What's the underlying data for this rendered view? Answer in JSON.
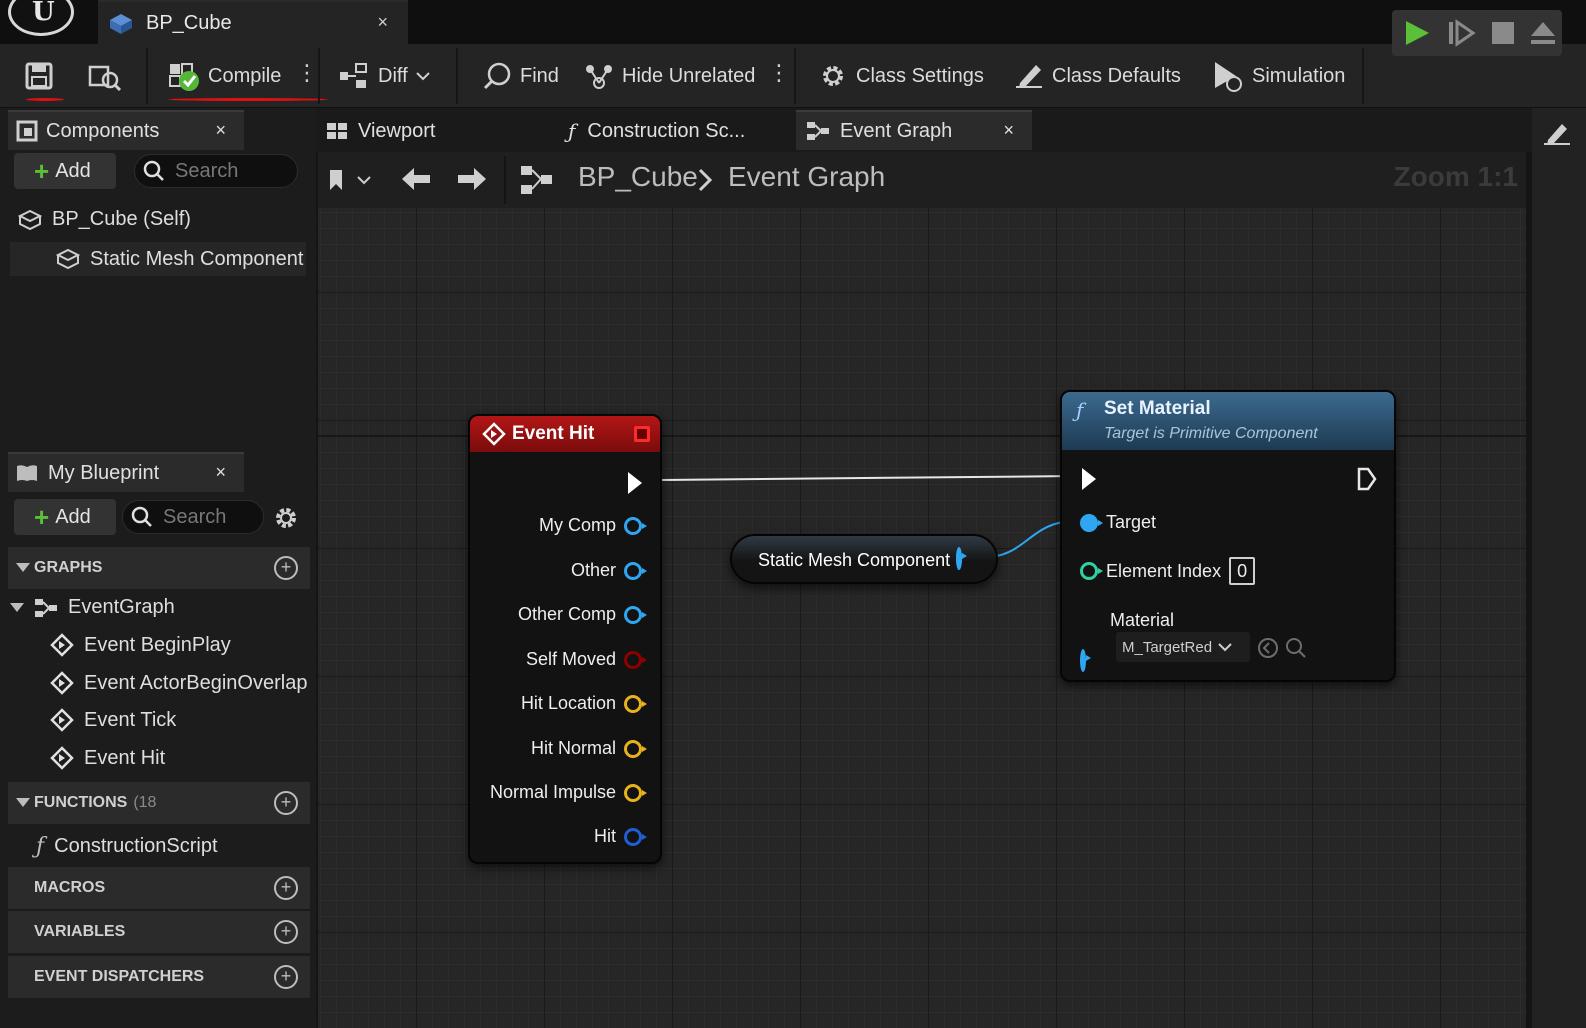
{
  "window": {
    "tab_title": "BP_Cube",
    "tab_close": "×"
  },
  "toolbar": {
    "compile": "Compile",
    "diff": "Diff",
    "find": "Find",
    "hide_unrelated": "Hide Unrelated",
    "class_settings": "Class Settings",
    "class_defaults": "Class Defaults",
    "simulation": "Simulation",
    "more": "⋮"
  },
  "components": {
    "tab": "Components",
    "close": "×",
    "add": "Add",
    "search_placeholder": "Search",
    "items": [
      "BP_Cube (Self)",
      "Static Mesh Component"
    ]
  },
  "my_blueprint": {
    "tab": "My Blueprint",
    "close": "×",
    "add": "Add",
    "search_placeholder": "Search",
    "graphs_header": "GRAPHS",
    "event_graph": "EventGraph",
    "events": [
      "Event BeginPlay",
      "Event ActorBeginOverlap",
      "Event Tick",
      "Event Hit"
    ],
    "functions_header": "FUNCTIONS",
    "functions_count": "(18 ",
    "construction_script": "ConstructionScript",
    "macros_header": "MACROS",
    "variables_header": "VARIABLES",
    "dispatchers_header": "EVENT DISPATCHERS"
  },
  "editor_tabs": {
    "viewport": "Viewport",
    "construction": "Construction Sc...",
    "event_graph": "Event Graph",
    "close": "×"
  },
  "breadcrumb": {
    "blueprint": "BP_Cube",
    "graph": "Event Graph",
    "zoom": "Zoom 1:1"
  },
  "nodes": {
    "event_hit": {
      "title": "Event Hit",
      "pins": [
        "My Comp",
        "Other",
        "Other Comp",
        "Self Moved",
        "Hit Location",
        "Hit Normal",
        "Normal Impulse",
        "Hit"
      ]
    },
    "static_mesh": {
      "title": "Static Mesh Component"
    },
    "set_material": {
      "title": "Set Material",
      "subtitle": "Target is Primitive Component",
      "target": "Target",
      "element_index": "Element Index",
      "element_index_value": "0",
      "material": "Material",
      "material_value": "M_TargetRed"
    }
  },
  "colors": {
    "object_pin": "#2fa6f2",
    "struct_pin": "#e8b21b",
    "bool_pin": "#8f0000",
    "int_pin": "#2fd1a4",
    "event_header": "#a11212",
    "function_header": "#2a4e6b",
    "play_green": "#5bc038"
  }
}
